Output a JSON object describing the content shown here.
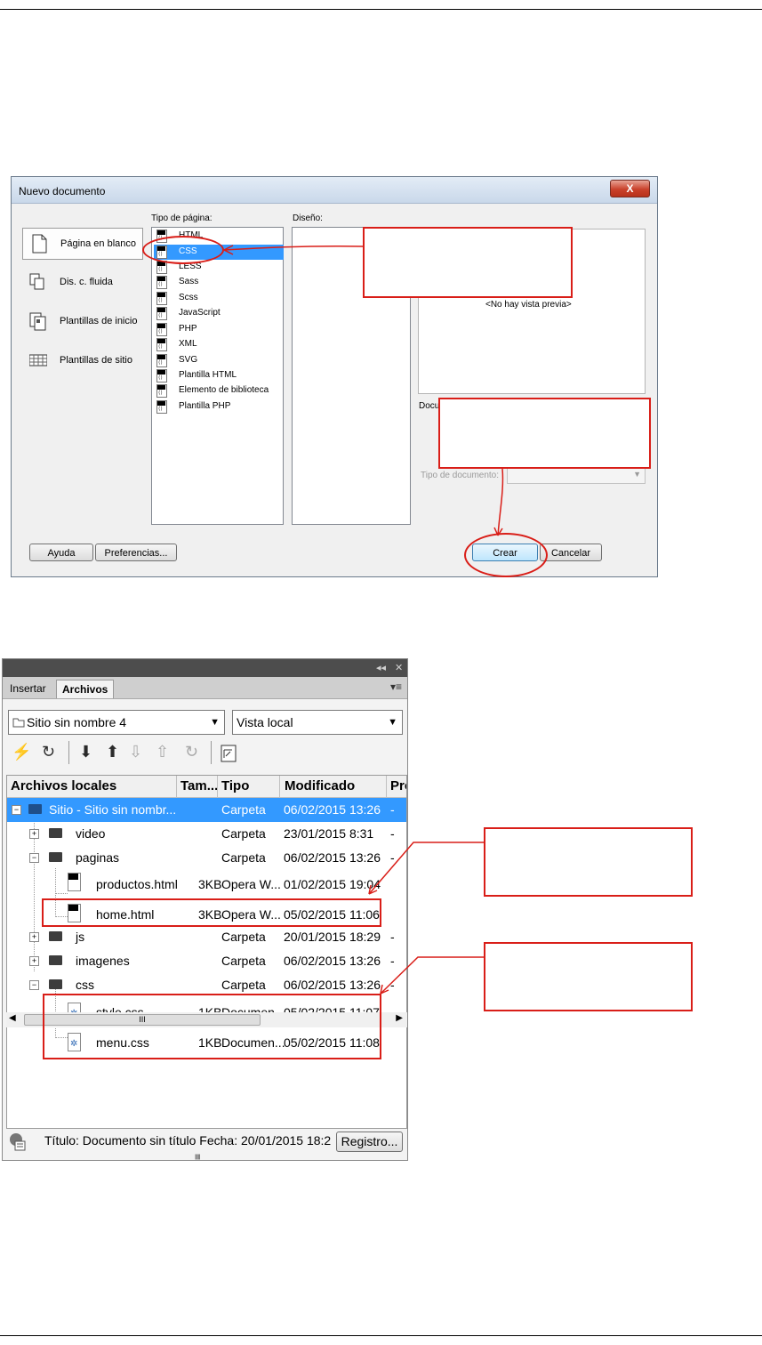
{
  "dialog": {
    "title": "Nuevo documento",
    "close_label": "X",
    "categories": [
      {
        "label": "Página en blanco",
        "icon": "blank-page-icon"
      },
      {
        "label": "Dis. c. fluida",
        "icon": "fluid-layout-icon"
      },
      {
        "label": "Plantillas de inicio",
        "icon": "starter-templates-icon"
      },
      {
        "label": "Plantillas de sitio",
        "icon": "site-templates-icon"
      }
    ],
    "page_type_label": "Tipo de página:",
    "page_types": [
      "HTML",
      "CSS",
      "LESS",
      "Sass",
      "Scss",
      "JavaScript",
      "PHP",
      "XML",
      "SVG",
      "Plantilla HTML",
      "Elemento de biblioteca",
      "Plantilla PHP"
    ],
    "selected_page_type": "CSS",
    "design_label": "Diseño:",
    "preview_text": "<No hay vista previa>",
    "description_label": "Docu",
    "doctype_label": "Tipo de documento:",
    "buttons": {
      "help": "Ayuda",
      "preferences": "Preferencias...",
      "create": "Crear",
      "cancel": "Cancelar"
    }
  },
  "files_panel": {
    "header_controls": {
      "collapse": "◂◂",
      "close": "✕"
    },
    "tabs": [
      "Insertar",
      "Archivos"
    ],
    "active_tab": "Archivos",
    "site_dropdown": "Sitio sin nombre 4",
    "view_dropdown": "Vista local",
    "toolbar_icons": [
      "disconnect-icon",
      "refresh-icon",
      "get-files-icon",
      "put-files-icon",
      "check-out-icon",
      "check-in-icon",
      "synchronize-icon",
      "expand-view-icon"
    ],
    "columns": [
      "Archivos locales",
      "Tam...",
      "Tipo",
      "Modificado",
      "Pro"
    ],
    "rows": [
      {
        "name": "Sitio - Sitio sin nombr...",
        "size": "",
        "type": "Carpeta",
        "modified": "06/02/2015 13:26",
        "extra": "-",
        "kind": "root"
      },
      {
        "name": "video",
        "size": "",
        "type": "Carpeta",
        "modified": "23/01/2015 8:31",
        "extra": "-",
        "kind": "folder",
        "expander": "+"
      },
      {
        "name": "paginas",
        "size": "",
        "type": "Carpeta",
        "modified": "06/02/2015 13:26",
        "extra": "-",
        "kind": "folder",
        "expander": "−"
      },
      {
        "name": "productos.html",
        "size": "3KB",
        "type": "Opera W...",
        "modified": "01/02/2015 19:04",
        "extra": "",
        "kind": "html"
      },
      {
        "name": "home.html",
        "size": "3KB",
        "type": "Opera W...",
        "modified": "05/02/2015 11:06",
        "extra": "",
        "kind": "html"
      },
      {
        "name": "js",
        "size": "",
        "type": "Carpeta",
        "modified": "20/01/2015 18:29",
        "extra": "-",
        "kind": "folder",
        "expander": "+"
      },
      {
        "name": "imagenes",
        "size": "",
        "type": "Carpeta",
        "modified": "06/02/2015 13:26",
        "extra": "-",
        "kind": "folder",
        "expander": "+"
      },
      {
        "name": "css",
        "size": "",
        "type": "Carpeta",
        "modified": "06/02/2015 13:26",
        "extra": "-",
        "kind": "folder",
        "expander": "−"
      },
      {
        "name": "style.css",
        "size": "1KB",
        "type": "Documen...",
        "modified": "05/02/2015 11:07",
        "extra": "",
        "kind": "css"
      },
      {
        "name": "menu.css",
        "size": "1KB",
        "type": "Documen...",
        "modified": "05/02/2015 11:08",
        "extra": "",
        "kind": "css"
      }
    ],
    "scroll_thumb": "III",
    "status_text": "Título: Documento sin título  Fecha: 20/01/2015 18:2",
    "log_button": "Registro..."
  },
  "annotation_color": "#d91e18",
  "selection_color": "#3399ff"
}
